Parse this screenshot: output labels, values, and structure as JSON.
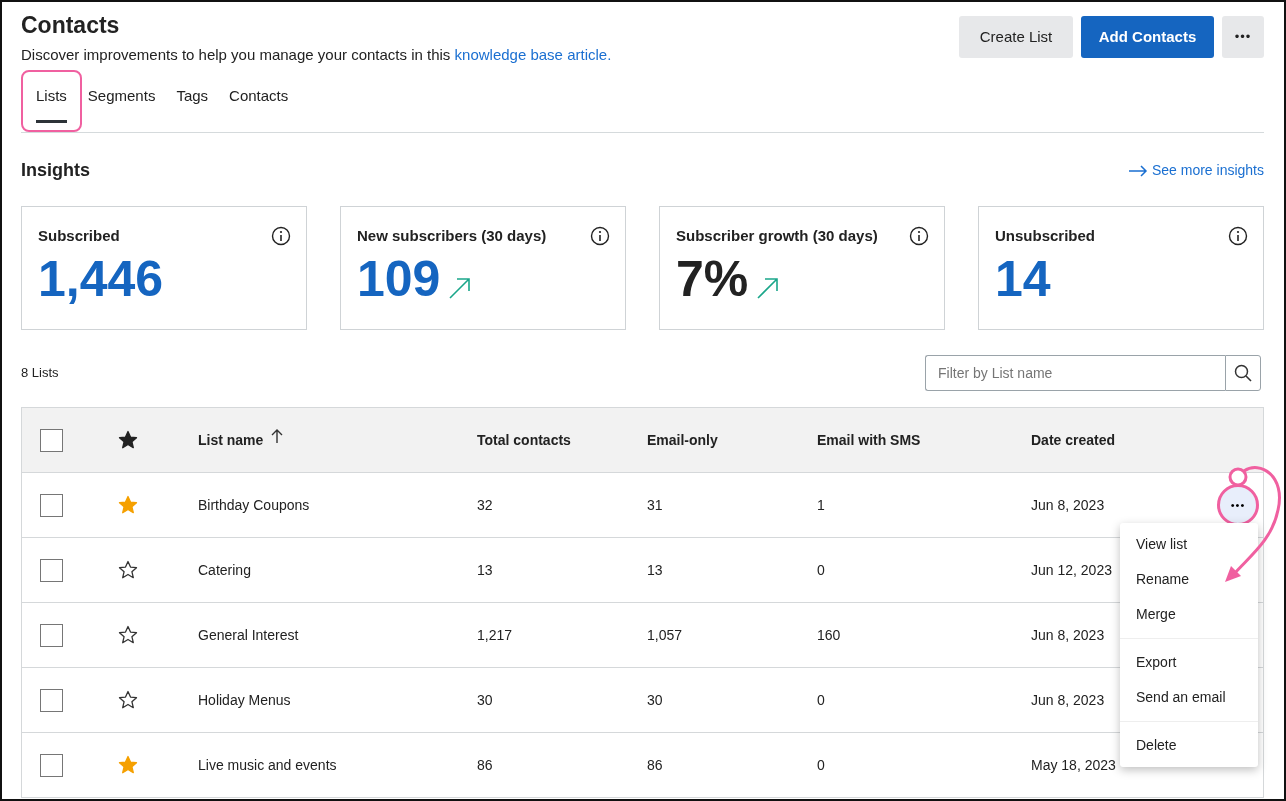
{
  "header": {
    "title": "Contacts",
    "subtitle": "Discover improvements to help you manage your contacts in this ",
    "subtitle_link": "knowledge base article.",
    "buttons": [
      {
        "label": "Create List",
        "kind": "secondary"
      },
      {
        "label": "Add Contacts",
        "kind": "primary"
      },
      {
        "label": "•••",
        "kind": "more"
      }
    ]
  },
  "tabs": [
    {
      "label": "Lists",
      "selected": true,
      "highlighted": true
    },
    {
      "label": "Segments",
      "selected": false,
      "highlighted": false
    },
    {
      "label": "Tags",
      "selected": false,
      "highlighted": false
    },
    {
      "label": "Contacts",
      "selected": false,
      "highlighted": false
    }
  ],
  "insights": {
    "title": "Insights",
    "link": "See more insights",
    "cards": [
      {
        "label": "Subscribed",
        "value": "1,446",
        "color": "#1565c0",
        "trend": false
      },
      {
        "label": "New subscribers (30 days)",
        "value": "109",
        "color": "#1565c0",
        "trend": true
      },
      {
        "label": "Subscriber growth (30 days)",
        "value": "7%",
        "color": "#222222",
        "trend": true
      },
      {
        "label": "Unsubscribed",
        "value": "14",
        "color": "#1565c0",
        "trend": false
      }
    ]
  },
  "lists": {
    "count": "8 Lists",
    "select_all_checked": false,
    "filter": {
      "placeholder": "Filter by List name"
    },
    "columns": [
      "List name",
      "Total contacts",
      "Email-only",
      "Email with SMS",
      "Date created"
    ],
    "rows": [
      {
        "checked": false,
        "favorite": true,
        "name": "Birthday Coupons",
        "total": "32",
        "email_only": "31",
        "sms": "1",
        "date": "Jun 8, 2023",
        "actions": "•••",
        "menu_open": true
      },
      {
        "checked": false,
        "favorite": false,
        "name": "Catering",
        "total": "13",
        "email_only": "13",
        "sms": "0",
        "date": "Jun 12, 2023",
        "menu_open": false
      },
      {
        "checked": false,
        "favorite": false,
        "name": "General Interest",
        "total": "1,217",
        "email_only": "1,057",
        "sms": "160",
        "date": "Jun 8, 2023",
        "menu_open": false
      },
      {
        "checked": false,
        "favorite": false,
        "name": "Holiday Menus",
        "total": "30",
        "email_only": "30",
        "sms": "0",
        "date": "Jun 8, 2023",
        "menu_open": false
      },
      {
        "checked": false,
        "favorite": true,
        "name": "Live music and events",
        "total": "86",
        "email_only": "86",
        "sms": "0",
        "date": "May 18, 2023",
        "menu_open": false
      }
    ],
    "menu": [
      {
        "label": "View list",
        "divider_before": false
      },
      {
        "label": "Rename",
        "divider_before": false
      },
      {
        "label": "Merge",
        "divider_before": false
      },
      {
        "label": "Export",
        "divider_before": true
      },
      {
        "label": "Send an email",
        "divider_before": false
      },
      {
        "label": "Delete",
        "divider_before": true
      }
    ]
  }
}
